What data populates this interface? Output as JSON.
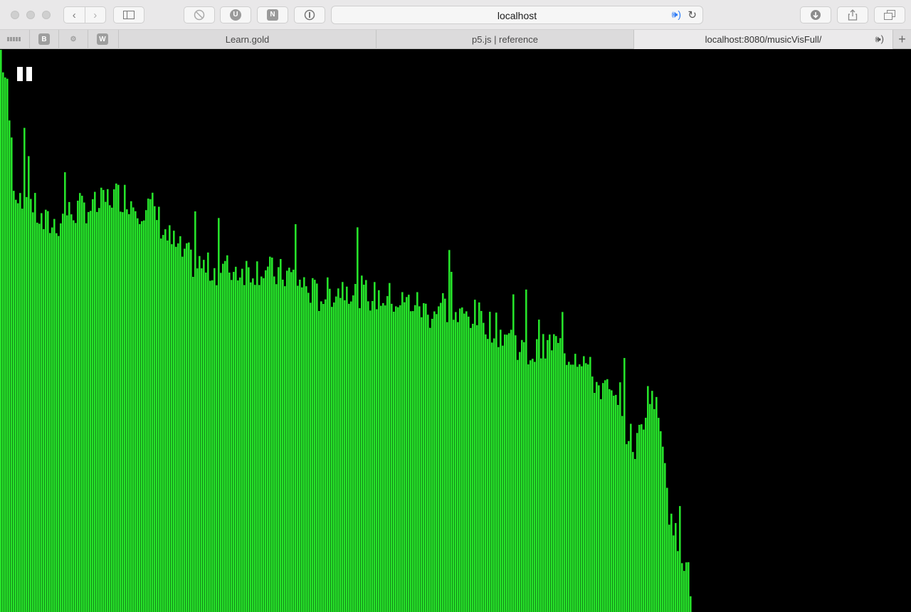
{
  "toolbar": {
    "url_text": "localhost",
    "icons": {
      "back": "chevron-left-icon",
      "forward": "chevron-right-icon",
      "sidebar": "sidebar-icon",
      "block": "block-icon",
      "ublock": "U",
      "onenote": "N",
      "onepassword": "password-icon",
      "audio": "speaker-icon",
      "reload": "reload-icon",
      "download": "download-icon",
      "share": "share-icon",
      "tabs": "tabs-overview-icon"
    },
    "accent": "#2f7cf6"
  },
  "favorites": [
    {
      "label": "B"
    },
    {
      "label": "W"
    }
  ],
  "tabs": [
    {
      "title": "Learn.gold",
      "active": false
    },
    {
      "title": "p5.js | reference",
      "active": false
    },
    {
      "title": "localhost:8080/musicVisFull/",
      "active": true,
      "audio": true
    }
  ],
  "visualizer": {
    "bar_color": "#26e22a",
    "background": "#000000",
    "paused_icon": "pause-icon",
    "type": "bar",
    "ylim": [
      0,
      1
    ],
    "active_fraction": 0.758,
    "envelope": [
      [
        0.0,
        1.0
      ],
      [
        0.01,
        0.92
      ],
      [
        0.02,
        0.75
      ],
      [
        0.04,
        0.74
      ],
      [
        0.06,
        0.69
      ],
      [
        0.08,
        0.69
      ],
      [
        0.1,
        0.71
      ],
      [
        0.12,
        0.72
      ],
      [
        0.14,
        0.72
      ],
      [
        0.16,
        0.74
      ],
      [
        0.18,
        0.74
      ],
      [
        0.2,
        0.72
      ],
      [
        0.22,
        0.72
      ],
      [
        0.24,
        0.67
      ],
      [
        0.26,
        0.64
      ],
      [
        0.28,
        0.62
      ],
      [
        0.3,
        0.61
      ],
      [
        0.32,
        0.61
      ],
      [
        0.34,
        0.61
      ],
      [
        0.36,
        0.61
      ],
      [
        0.38,
        0.61
      ],
      [
        0.4,
        0.6
      ],
      [
        0.42,
        0.6
      ],
      [
        0.44,
        0.58
      ],
      [
        0.46,
        0.56
      ],
      [
        0.48,
        0.57
      ],
      [
        0.5,
        0.58
      ],
      [
        0.52,
        0.57
      ],
      [
        0.54,
        0.56
      ],
      [
        0.56,
        0.56
      ],
      [
        0.58,
        0.55
      ],
      [
        0.6,
        0.55
      ],
      [
        0.62,
        0.53
      ],
      [
        0.64,
        0.55
      ],
      [
        0.66,
        0.52
      ],
      [
        0.68,
        0.53
      ],
      [
        0.7,
        0.52
      ],
      [
        0.72,
        0.5
      ],
      [
        0.74,
        0.49
      ],
      [
        0.76,
        0.46
      ],
      [
        0.78,
        0.46
      ],
      [
        0.8,
        0.48
      ],
      [
        0.82,
        0.46
      ],
      [
        0.84,
        0.46
      ],
      [
        0.86,
        0.41
      ],
      [
        0.88,
        0.39
      ],
      [
        0.9,
        0.34
      ],
      [
        0.92,
        0.29
      ],
      [
        0.94,
        0.4
      ],
      [
        0.96,
        0.31
      ],
      [
        0.97,
        0.15
      ],
      [
        0.985,
        0.12
      ],
      [
        1.0,
        0.04
      ]
    ]
  }
}
